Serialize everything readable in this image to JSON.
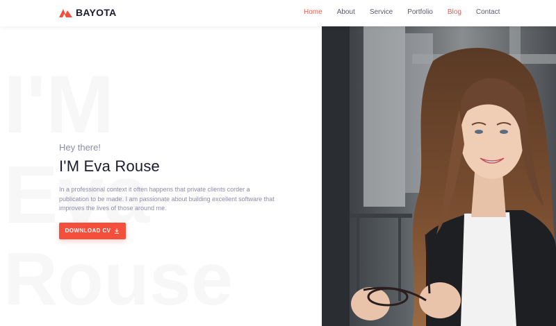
{
  "brand": {
    "name": "BAYOTA",
    "logo_icon": "mountain-logo-icon",
    "accent": "#f44f3b"
  },
  "nav": {
    "items": [
      {
        "label": "Home",
        "active": true
      },
      {
        "label": "About"
      },
      {
        "label": "Service"
      },
      {
        "label": "Portfolio"
      },
      {
        "label": "Blog",
        "highlight": true
      },
      {
        "label": "Contact"
      }
    ]
  },
  "background_words": [
    "I'M",
    "Eva",
    "Rouse"
  ],
  "hero": {
    "greeting": "Hey there!",
    "name": "I'M Eva Rouse",
    "description": "In a professional context it often happens that private clients corder a publication to be made. I am passionate about building excellent software that improves the lives of those around me.",
    "cta_label": "DOWNLOAD CV",
    "cta_icon": "download-icon"
  },
  "photo": {
    "subject": "portrait-photo"
  }
}
